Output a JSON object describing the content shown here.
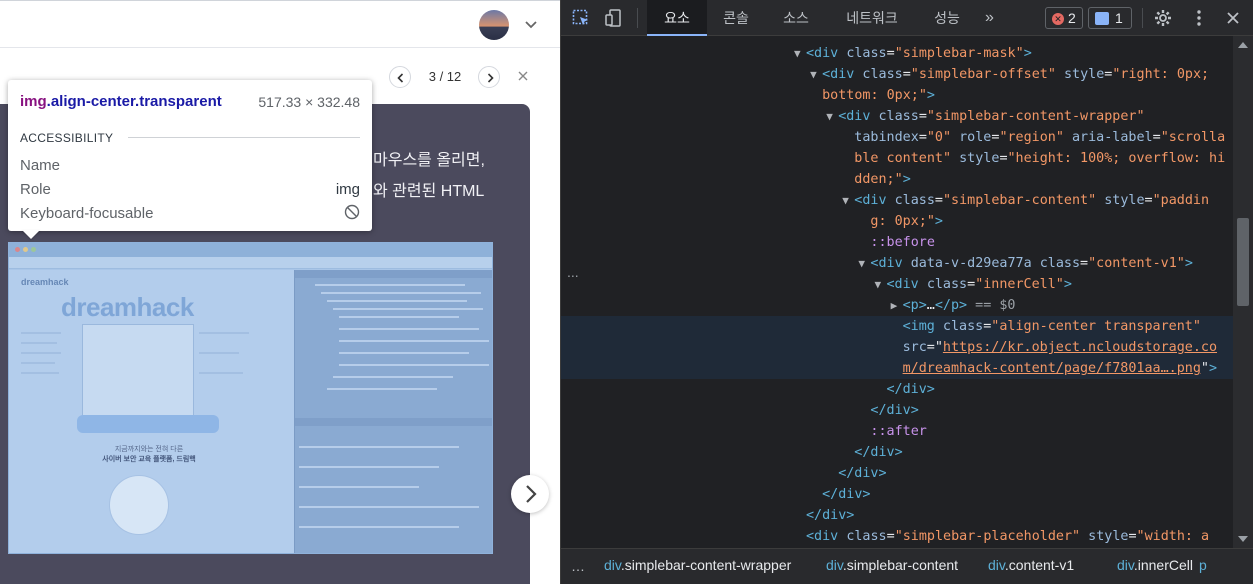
{
  "left": {
    "pager": {
      "count": "3 / 12"
    },
    "card_lines": [
      "마우스를 올리면,",
      "와 관련된 HTML"
    ],
    "screenshot": {
      "brand": "dreamhack",
      "logo": "dreamhack",
      "caption1": "지금까지와는 전혀 다른",
      "caption2": "사이버 보안 교육 플랫폼, 드림핵"
    }
  },
  "tooltip": {
    "tag": "img",
    "classes": ".align-center.transparent",
    "size": "517.33 × 332.48",
    "section": "ACCESSIBILITY",
    "rows": [
      {
        "label": "Name",
        "value": ""
      },
      {
        "label": "Role",
        "value": "img"
      },
      {
        "label": "Keyboard-focusable",
        "value": ""
      }
    ]
  },
  "devtools": {
    "tabs": [
      "요소",
      "콘솔",
      "소스",
      "네트워크",
      "성능"
    ],
    "active_tab": "요소",
    "error_count": "2",
    "message_count": "1",
    "more": "»",
    "gutter": "...",
    "lines": [
      {
        "indent": 16,
        "arrow": "▼",
        "segs": [
          [
            "tag",
            "<div "
          ],
          [
            "attr",
            "class"
          ],
          [
            "plain",
            "="
          ],
          [
            "val",
            "\"simplebar-mask\""
          ],
          [
            "tag",
            ">"
          ]
        ]
      },
      {
        "indent": 18,
        "arrow": "▼",
        "segs": [
          [
            "tag",
            "<div "
          ],
          [
            "attr",
            "class"
          ],
          [
            "plain",
            "="
          ],
          [
            "val",
            "\"simplebar-offset\" "
          ],
          [
            "attr",
            "style"
          ],
          [
            "plain",
            "="
          ],
          [
            "val",
            "\"right: 0px;"
          ]
        ]
      },
      {
        "indent": 18,
        "arrow": "",
        "segs": [
          [
            "val",
            "bottom: 0px;\""
          ],
          [
            "tag",
            ">"
          ]
        ]
      },
      {
        "indent": 20,
        "arrow": "▼",
        "segs": [
          [
            "tag",
            "<div "
          ],
          [
            "attr",
            "class"
          ],
          [
            "plain",
            "="
          ],
          [
            "val",
            "\"simplebar-content-wrapper\""
          ]
        ]
      },
      {
        "indent": 20,
        "arrow": "",
        "segs": [
          [
            "attr",
            "  tabindex"
          ],
          [
            "plain",
            "="
          ],
          [
            "val",
            "\"0\" "
          ],
          [
            "attr",
            "role"
          ],
          [
            "plain",
            "="
          ],
          [
            "val",
            "\"region\" "
          ],
          [
            "attr",
            "aria-label"
          ],
          [
            "plain",
            "="
          ],
          [
            "val",
            "\"scrolla"
          ]
        ]
      },
      {
        "indent": 20,
        "arrow": "",
        "segs": [
          [
            "val",
            "  ble content\" "
          ],
          [
            "attr",
            "style"
          ],
          [
            "plain",
            "="
          ],
          [
            "val",
            "\"height: 100%; overflow: hi"
          ]
        ]
      },
      {
        "indent": 20,
        "arrow": "",
        "segs": [
          [
            "val",
            "  dden;\""
          ],
          [
            "tag",
            ">"
          ]
        ]
      },
      {
        "indent": 22,
        "arrow": "▼",
        "segs": [
          [
            "tag",
            "<div "
          ],
          [
            "attr",
            "class"
          ],
          [
            "plain",
            "="
          ],
          [
            "val",
            "\"simplebar-content\" "
          ],
          [
            "attr",
            "style"
          ],
          [
            "plain",
            "="
          ],
          [
            "val",
            "\"paddin"
          ]
        ]
      },
      {
        "indent": 22,
        "arrow": "",
        "segs": [
          [
            "val",
            "  g: 0px;\""
          ],
          [
            "tag",
            ">"
          ]
        ]
      },
      {
        "indent": 24,
        "arrow": "",
        "segs": [
          [
            "pseudo",
            "::before"
          ]
        ]
      },
      {
        "indent": 24,
        "arrow": "▼",
        "segs": [
          [
            "tag",
            "<div "
          ],
          [
            "attr",
            "data-v-d29ea77a "
          ],
          [
            "attr",
            "class"
          ],
          [
            "plain",
            "="
          ],
          [
            "val",
            "\"content-v1\""
          ],
          [
            "tag",
            ">"
          ]
        ]
      },
      {
        "indent": 26,
        "arrow": "▼",
        "segs": [
          [
            "tag",
            "<div "
          ],
          [
            "attr",
            "class"
          ],
          [
            "plain",
            "="
          ],
          [
            "val",
            "\"innerCell\""
          ],
          [
            "tag",
            ">"
          ]
        ]
      },
      {
        "indent": 28,
        "arrow": "▶",
        "segs": [
          [
            "tag",
            "<p>"
          ],
          [
            "plain",
            "…"
          ],
          [
            "tag",
            "</p>"
          ],
          [
            "dim",
            " == "
          ],
          [
            "dim",
            "$0"
          ]
        ]
      },
      {
        "indent": 28,
        "arrow": "",
        "sel": true,
        "segs": [
          [
            "tag",
            "<img "
          ],
          [
            "attr",
            "class"
          ],
          [
            "plain",
            "="
          ],
          [
            "val",
            "\"align-center transparent\""
          ]
        ]
      },
      {
        "indent": 28,
        "arrow": "",
        "sel": true,
        "segs": [
          [
            "attr",
            "src"
          ],
          [
            "plain",
            "=\""
          ],
          [
            "link",
            "https://kr.object.ncloudstorage.co"
          ]
        ]
      },
      {
        "indent": 28,
        "arrow": "",
        "sel": true,
        "segs": [
          [
            "link",
            "m/dreamhack-content/page/f7801aa….png"
          ],
          [
            "plain",
            "\""
          ],
          [
            "tag",
            ">"
          ]
        ]
      },
      {
        "indent": 26,
        "arrow": "",
        "segs": [
          [
            "tag",
            "</div>"
          ]
        ]
      },
      {
        "indent": 24,
        "arrow": "",
        "segs": [
          [
            "tag",
            "</div>"
          ]
        ]
      },
      {
        "indent": 24,
        "arrow": "",
        "segs": [
          [
            "pseudo",
            "::after"
          ]
        ]
      },
      {
        "indent": 22,
        "arrow": "",
        "segs": [
          [
            "tag",
            "</div>"
          ]
        ]
      },
      {
        "indent": 20,
        "arrow": "",
        "segs": [
          [
            "tag",
            "</div>"
          ]
        ]
      },
      {
        "indent": 18,
        "arrow": "",
        "segs": [
          [
            "tag",
            "</div>"
          ]
        ]
      },
      {
        "indent": 16,
        "arrow": "",
        "segs": [
          [
            "tag",
            "</div>"
          ]
        ]
      },
      {
        "indent": 16,
        "arrow": "",
        "segs": [
          [
            "tag",
            "<div "
          ],
          [
            "attr",
            "class"
          ],
          [
            "plain",
            "="
          ],
          [
            "val",
            "\"simplebar-placeholder\" "
          ],
          [
            "attr",
            "style"
          ],
          [
            "plain",
            "="
          ],
          [
            "val",
            "\"width: a"
          ]
        ]
      }
    ],
    "crumbs": [
      {
        "tag": "div",
        "cls": ".simplebar-content-wrapper"
      },
      {
        "tag": "div",
        "cls": ".simplebar-content"
      },
      {
        "tag": "div",
        "cls": ".content-v1"
      },
      {
        "tag": "div",
        "cls": ".innerCell"
      },
      {
        "tag": "p",
        "cls": ""
      }
    ]
  }
}
